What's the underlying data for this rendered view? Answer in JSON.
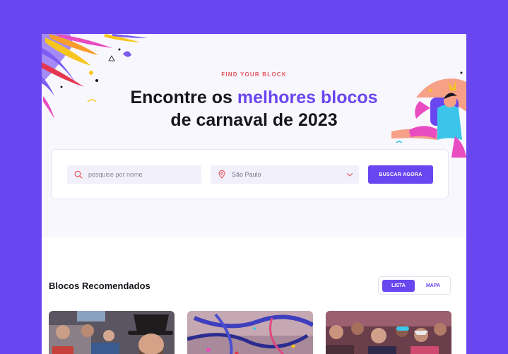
{
  "hero": {
    "eyebrow": "FIND YOUR BLOCK",
    "title_line1_prefix": "Encontre os ",
    "title_line1_highlight": "melhores blocos",
    "title_line2": "de carnaval de 2023"
  },
  "search": {
    "name_placeholder": "pesquise por nome",
    "location_value": "São Paulo",
    "button_label": "BUSCAR AGORA"
  },
  "recommended": {
    "section_title": "Blocos Recomendados",
    "view_toggle": {
      "list_label": "LISTA",
      "map_label": "MAPA",
      "active": "LISTA"
    }
  },
  "cards": [
    {
      "photo": "man-in-top-hat-crowd"
    },
    {
      "photo": "streamers-and-confetti"
    },
    {
      "photo": "carnival-crowd-masks"
    }
  ],
  "colors": {
    "background": "#6a46f0",
    "accent": "#6a46f0",
    "eyebrow": "#e4555c",
    "hero_bg": "#f8f7fe"
  },
  "icons": {
    "search": "search-icon",
    "location": "location-pin-icon",
    "dropdown": "chevron-down-icon"
  }
}
